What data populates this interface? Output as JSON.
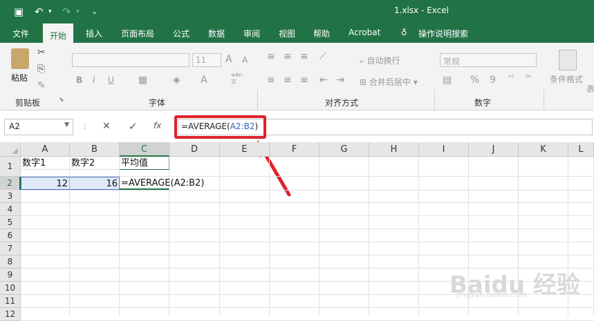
{
  "title": "1.xlsx  -  Excel",
  "quick_access": {
    "save": "save-icon",
    "undo": "undo-icon",
    "redo": "redo-icon",
    "more": "customize-icon"
  },
  "tabs": [
    "文件",
    "开始",
    "插入",
    "页面布局",
    "公式",
    "数据",
    "审阅",
    "视图",
    "帮助",
    "Acrobat",
    "操作说明搜索"
  ],
  "ribbon": {
    "paste": "粘贴",
    "clipboard": "剪贴板",
    "font": "字体",
    "font_size": "11",
    "align": "对齐方式",
    "wrap": "自动换行",
    "merge": "合并后居中",
    "number": "数字",
    "number_format": "常规",
    "conditional": "条件格式",
    "more": "表",
    "bold": "B",
    "italic": "I",
    "underline": "U",
    "percent": "%",
    "comma": "9",
    "wen": "wén",
    "wen2": "文"
  },
  "formula_bar": {
    "name_box": "A2",
    "cancel": "✕",
    "enter": "✓",
    "fx": "fx",
    "formula_prefix": "=AVERAGE(",
    "formula_ref": "A2:B2",
    "formula_suffix": ")"
  },
  "columns": [
    "A",
    "B",
    "C",
    "D",
    "E",
    "F",
    "G",
    "H",
    "I",
    "J",
    "K",
    "L"
  ],
  "rows": [
    "1",
    "2",
    "3",
    "4",
    "5",
    "6",
    "7",
    "8",
    "9",
    "10",
    "11",
    "12"
  ],
  "cells": {
    "A1": "数字1",
    "B1": "数字2",
    "C1": "平均值",
    "A2": "12",
    "B2": "16",
    "C2": "=AVERAGE(A2:B2)"
  },
  "watermark": {
    "main": "Baidu 经验",
    "sub": "jingyan.baidu.com"
  }
}
